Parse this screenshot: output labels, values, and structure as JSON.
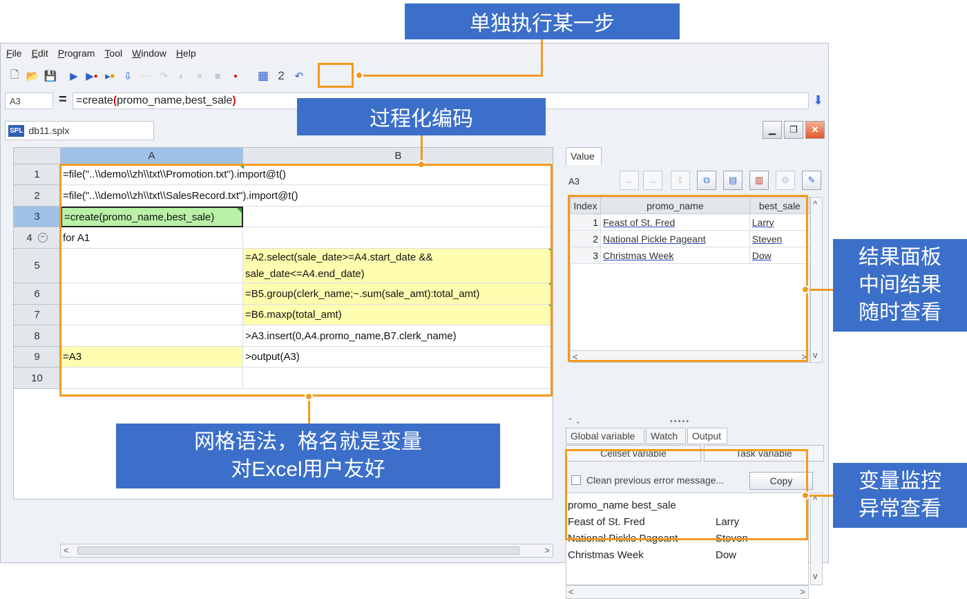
{
  "app": {
    "menu": [
      "File",
      "Edit",
      "Program",
      "Tool",
      "Window",
      "Help"
    ],
    "toolbar_icons": [
      "new-icon",
      "open-icon",
      "save-icon",
      "run-icon",
      "debug-icon",
      "step-icon",
      "calc-icon",
      "stop-icon",
      "breakpoint-icon",
      "calculator-icon",
      "undo-icon"
    ],
    "toolbar_extra_label": "2"
  },
  "formula_bar": {
    "cell_ref": "A3",
    "equals": "=",
    "formula_prefix": "=create",
    "formula_open": "(",
    "formula_args": "promo_name,best_sale",
    "formula_close": ")"
  },
  "file_tab": {
    "badge": "SPL",
    "name": "db11.splx"
  },
  "grid": {
    "columns": [
      "A",
      "B"
    ],
    "rows": [
      {
        "num": "1",
        "a": "=file(\"..\\\\demo\\\\zh\\\\txt\\\\Promotion.txt\").import@t()",
        "b": ""
      },
      {
        "num": "2",
        "a": "=file(\"..\\\\demo\\\\zh\\\\txt\\\\SalesRecord.txt\").import@t()",
        "b": ""
      },
      {
        "num": "3",
        "a": "=create(promo_name,best_sale)",
        "b": ""
      },
      {
        "num": "4",
        "a": "for A1",
        "b": ""
      },
      {
        "num": "5",
        "a": "",
        "b": "=A2.select(sale_date>=A4.start_date && sale_date<=A4.end_date)"
      },
      {
        "num": "6",
        "a": "",
        "b": "=B5.group(clerk_name;~.sum(sale_amt):total_amt)"
      },
      {
        "num": "7",
        "a": "",
        "b": "=B6.maxp(total_amt)"
      },
      {
        "num": "8",
        "a": "",
        "b": ">A3.insert(0,A4.promo_name,B7.clerk_name)"
      },
      {
        "num": "9",
        "a": "=A3",
        "b": ">output(A3)"
      },
      {
        "num": "10",
        "a": "",
        "b": ""
      }
    ]
  },
  "value_panel": {
    "tab": "Value",
    "cell_ref": "A3",
    "headers": [
      "Index",
      "promo_name",
      "best_sale"
    ],
    "rows": [
      {
        "index": "1",
        "promo_name": "Feast of St. Fred",
        "best_sale": "Larry"
      },
      {
        "index": "2",
        "promo_name": "National Pickle Pageant",
        "best_sale": "Steven"
      },
      {
        "index": "3",
        "promo_name": "Christmas Week",
        "best_sale": "Dow"
      }
    ]
  },
  "bottom_panel": {
    "tabs": [
      "Global variable",
      "Watch",
      "Output"
    ],
    "subtabs": [
      "Cellset variable",
      "Task variable"
    ],
    "clean_label": "Clean previous error message...",
    "copy_label": "Copy",
    "output_header": "promo_name best_sale",
    "output_rows": [
      {
        "c1": "Feast of St. Fred",
        "c2": "Larry"
      },
      {
        "c1": "National Pickle Pageant",
        "c2": "Steven"
      },
      {
        "c1": "Christmas Week",
        "c2": "Dow"
      }
    ]
  },
  "annotations": {
    "step": "单独执行某一步",
    "procedural": "过程化编码",
    "grid_line1": "网格语法，格名就是变量",
    "grid_line2": "对Excel用户友好",
    "result_line1": "结果面板",
    "result_line2": "中间结果",
    "result_line3": "随时查看",
    "watch_line1": "变量监控",
    "watch_line2": "异常查看"
  },
  "colors": {
    "callout": "#3b6fc9",
    "highlight": "#f29a1f",
    "cell_yellow": "#fffdb0",
    "cell_green": "#b9f2a7"
  }
}
